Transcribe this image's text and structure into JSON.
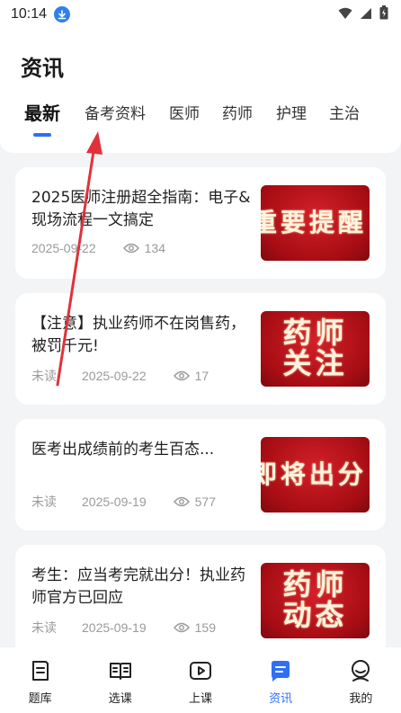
{
  "status_bar": {
    "time": "10:14"
  },
  "header": {
    "title": "资讯"
  },
  "tabs": [
    {
      "label": "最新",
      "active": true
    },
    {
      "label": "备考资料",
      "active": false
    },
    {
      "label": "医师",
      "active": false
    },
    {
      "label": "药师",
      "active": false
    },
    {
      "label": "护理",
      "active": false
    },
    {
      "label": "主治",
      "active": false
    }
  ],
  "articles": [
    {
      "title": "2025医师注册超全指南：电子&现场流程一文搞定",
      "unread": "",
      "date": "2025-09-22",
      "views": "134",
      "thumb_text": [
        "重要提醒"
      ]
    },
    {
      "title": "【注意】执业药师不在岗售药，被罚千元!",
      "unread": "未读",
      "date": "2025-09-22",
      "views": "17",
      "thumb_text": [
        "药师",
        "关注"
      ]
    },
    {
      "title": "医考出成绩前的考生百态...",
      "unread": "未读",
      "date": "2025-09-19",
      "views": "577",
      "thumb_text": [
        "即将出分"
      ]
    },
    {
      "title": "考生：应当考完就出分！执业药师官方已回应",
      "unread": "未读",
      "date": "2025-09-19",
      "views": "159",
      "thumb_text": [
        "药师",
        "动态"
      ]
    }
  ],
  "bottom_nav": [
    {
      "label": "题库",
      "icon": "question-bank-icon",
      "active": false
    },
    {
      "label": "选课",
      "icon": "course-select-icon",
      "active": false
    },
    {
      "label": "上课",
      "icon": "play-class-icon",
      "active": false
    },
    {
      "label": "资讯",
      "icon": "news-icon",
      "active": true
    },
    {
      "label": "我的",
      "icon": "profile-icon",
      "active": false
    }
  ],
  "colors": {
    "accent": "#2f6ff3",
    "annotation_arrow": "#e0323c",
    "thumb_red": "#c0121c"
  }
}
